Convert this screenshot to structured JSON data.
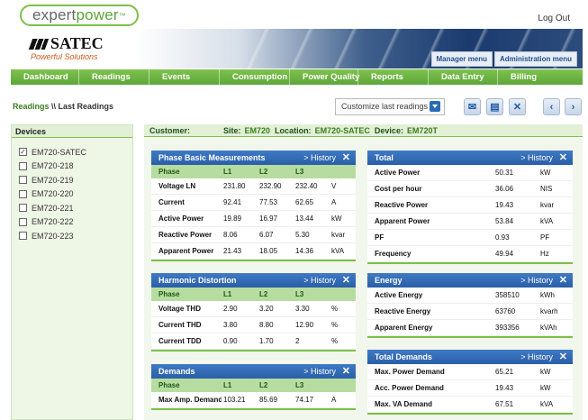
{
  "header": {
    "logo_prefix": "expert",
    "logo_brand": "power",
    "logo_tm": "™",
    "logout": "Log Out"
  },
  "banner": {
    "brand": "SATEC",
    "tagline": "Powerful Solutions",
    "tabs": [
      "Manager menu",
      "Administration menu"
    ]
  },
  "nav": [
    "Dashboard",
    "Readings",
    "Events",
    "Consumption",
    "Power Quality",
    "Reports",
    "Data Entry",
    "Billing"
  ],
  "breadcrumb": {
    "section": "Readings",
    "sep": " \\\\ ",
    "page": "Last Readings"
  },
  "toolbar": {
    "customize": "Customize last readings"
  },
  "devices": {
    "title": "Devices",
    "items": [
      {
        "name": "EM720-SATEC",
        "checked": "☑"
      },
      {
        "name": "EM720-218",
        "checked": ""
      },
      {
        "name": "EM720-219",
        "checked": ""
      },
      {
        "name": "EM720-220",
        "checked": ""
      },
      {
        "name": "EM720-221",
        "checked": ""
      },
      {
        "name": "EM720-222",
        "checked": ""
      },
      {
        "name": "EM720-223",
        "checked": ""
      }
    ]
  },
  "info": {
    "customer_label": "Customer:",
    "customer": "",
    "site_label": "Site:",
    "site": "EM720",
    "location_label": "Location:",
    "location": "EM720-SATEC",
    "device_label": "Device:",
    "device": "EM720T"
  },
  "panels": {
    "phase": {
      "title": "Phase Basic Measurements",
      "history": "> History",
      "cols": [
        "Phase",
        "L1",
        "L2",
        "L3"
      ],
      "rows": [
        [
          "Voltage LN",
          "231.80",
          "232.90",
          "232.40",
          "V"
        ],
        [
          "Current",
          "92.41",
          "77.53",
          "62.65",
          "A"
        ],
        [
          "Active Power",
          "19.89",
          "16.97",
          "13.44",
          "kW"
        ],
        [
          "Reactive Power",
          "8.06",
          "6.07",
          "5.30",
          "kvar"
        ],
        [
          "Apparent Power",
          "21.43",
          "18.05",
          "14.36",
          "kVA"
        ]
      ]
    },
    "total": {
      "title": "Total",
      "history": "> History",
      "rows": [
        [
          "Active Power",
          "50.31",
          "kW"
        ],
        [
          "Cost per hour",
          "36.06",
          "NIS"
        ],
        [
          "Reactive Power",
          "19.43",
          "kvar"
        ],
        [
          "Apparent Power",
          "53.84",
          "kVA"
        ],
        [
          "PF",
          "0.93",
          "PF"
        ],
        [
          "Frequency",
          "49.94",
          "Hz"
        ]
      ]
    },
    "harmonic": {
      "title": "Harmonic Distortion",
      "history": "> History",
      "cols": [
        "Phase",
        "L1",
        "L2",
        "L3"
      ],
      "rows": [
        [
          "Voltage THD",
          "2.90",
          "3.20",
          "3.30",
          "%"
        ],
        [
          "Current THD",
          "3.80",
          "8.80",
          "12.90",
          "%"
        ],
        [
          "Current TDD",
          "0.90",
          "1.70",
          "2",
          "%"
        ]
      ]
    },
    "energy": {
      "title": "Energy",
      "history": "> History",
      "rows": [
        [
          "Active Energy",
          "358510",
          "kWh"
        ],
        [
          "Reactive Energy",
          "63760",
          "kvarh"
        ],
        [
          "Apparent Energy",
          "393356",
          "kVAh"
        ]
      ]
    },
    "demands": {
      "title": "Demands",
      "history": "> History",
      "cols": [
        "Phase",
        "L1",
        "L2",
        "L3"
      ],
      "rows": [
        [
          "Max Amp. Demand",
          "103.21",
          "85.69",
          "74.17",
          "A"
        ]
      ]
    },
    "total_demands": {
      "title": "Total Demands",
      "history": "> History",
      "rows": [
        [
          "Max. Power Demand",
          "65.21",
          "kW"
        ],
        [
          "Acc. Power Demand",
          "19.43",
          "kW"
        ],
        [
          "Max. VA Demand",
          "67.51",
          "kVA"
        ]
      ]
    }
  },
  "colors": {
    "green": "#7cbf49",
    "blue_header": "#2a5fa8",
    "col_header_bg": "#b7dca0"
  }
}
